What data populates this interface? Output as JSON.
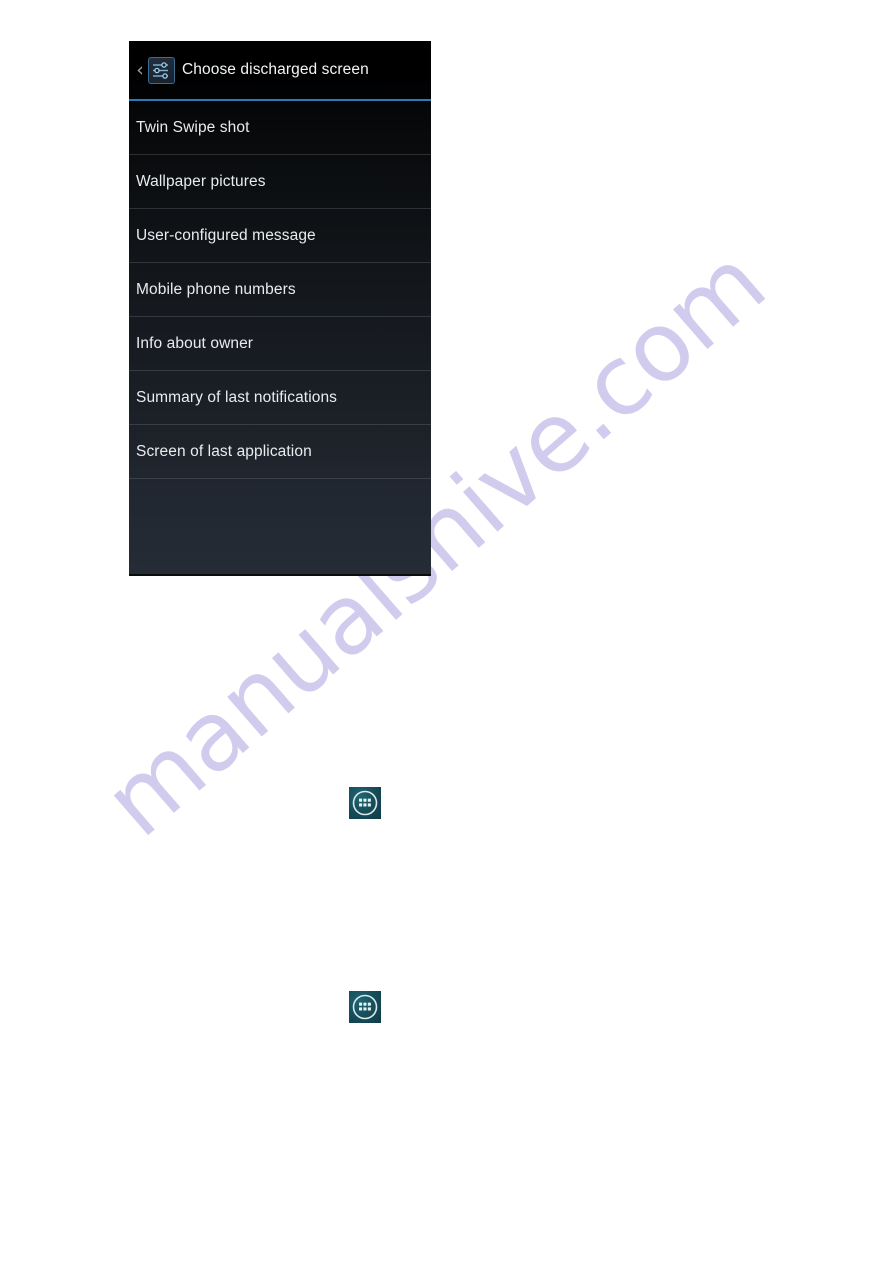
{
  "page": {
    "background_color": "#ffffff",
    "watermark": {
      "text": "manualshive.com",
      "color": "#c9c4ec"
    }
  },
  "phone_screenshot": {
    "header": {
      "back_label": "‹",
      "icon_name": "settings-sliders-icon",
      "title": "Choose discharged screen",
      "accent_color": "#2e79b8",
      "title_color": "#f2f4f6"
    },
    "list": {
      "items": [
        {
          "label": "Twin Swipe shot"
        },
        {
          "label": "Wallpaper pictures"
        },
        {
          "label": "User-configured message"
        },
        {
          "label": "Mobile phone numbers"
        },
        {
          "label": "Info about owner"
        },
        {
          "label": "Summary of last notifications"
        },
        {
          "label": "Screen of last application"
        }
      ]
    }
  },
  "app_drawer_icons": [
    {
      "name": "app-drawer-icon",
      "color": "#16505c"
    },
    {
      "name": "app-drawer-icon",
      "color": "#16505c"
    }
  ]
}
